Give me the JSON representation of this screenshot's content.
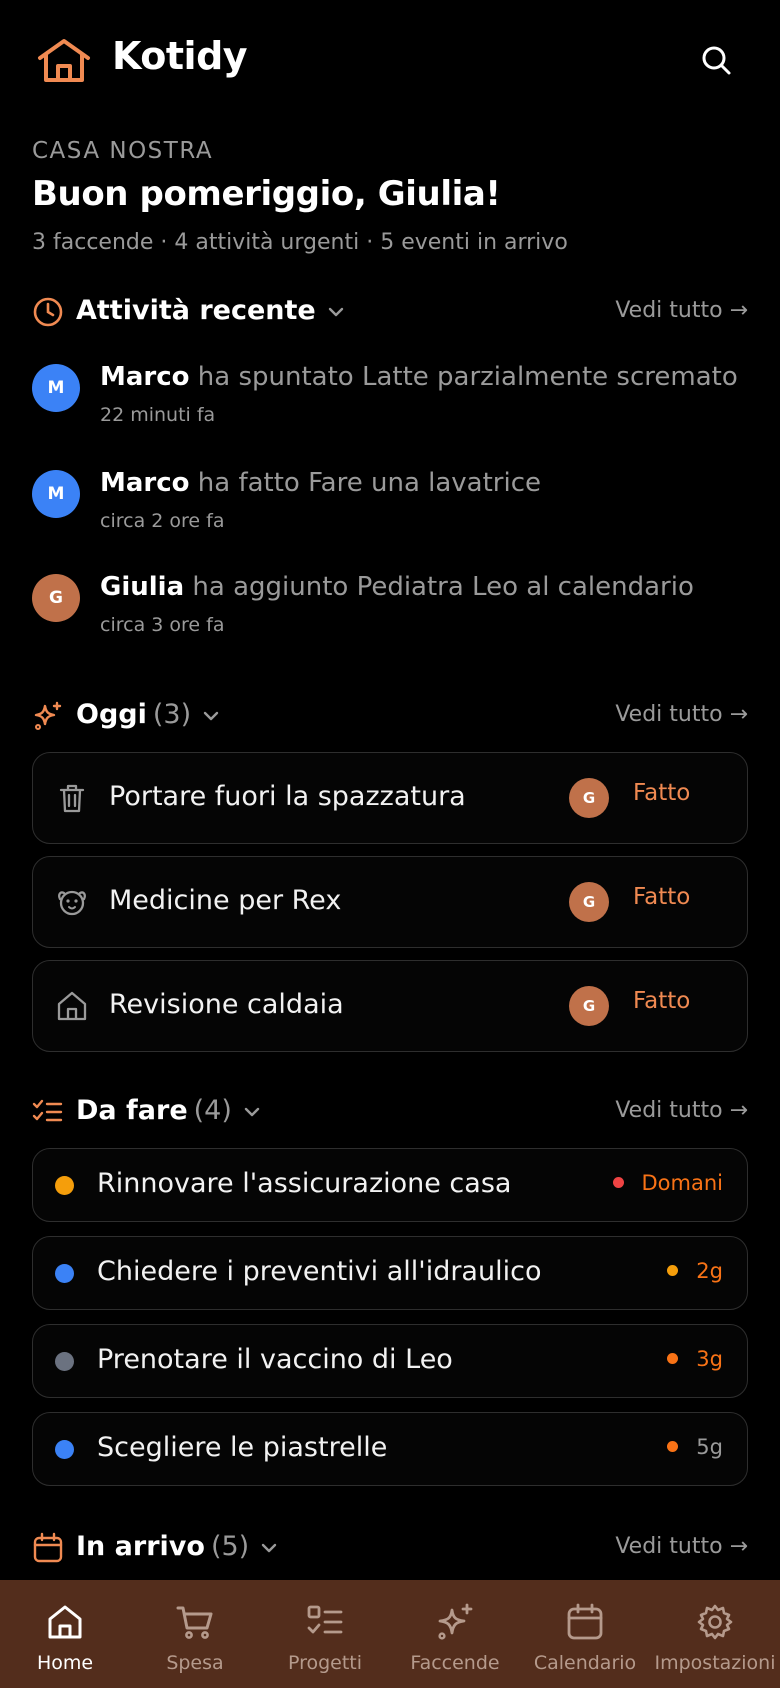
{
  "app": {
    "name": "Kotidy"
  },
  "colors": {
    "accent": "#f08a52",
    "background": "#000000",
    "nav_bg": "#532d1c",
    "blue": "#3b82f6",
    "red": "#ef4444",
    "amber": "#f59e0b",
    "gray": "#6b7280",
    "orange": "#f97316"
  },
  "header": {
    "household": "CASA NOSTRA",
    "greeting": "Buon pomeriggio, Giulia!",
    "summary": "3 faccende · 4 attività urgenti · 5 eventi in arrivo"
  },
  "recent": {
    "title": "Attività recente",
    "see_all": "Vedi tutto →",
    "items": [
      {
        "initial": "M",
        "name": "Marco",
        "action": "ha spuntato Latte parzialmente scremato",
        "time": "22 minuti fa"
      },
      {
        "initial": "M",
        "name": "Marco",
        "action": "ha fatto Fare una lavatrice",
        "time": "circa 2 ore fa"
      },
      {
        "initial": "G",
        "name": "Giulia",
        "action": "ha aggiunto Pediatra Leo al calendario",
        "time": "circa 3 ore fa"
      }
    ]
  },
  "today": {
    "title": "Oggi",
    "count": "(3)",
    "see_all": "Vedi tutto →",
    "items": [
      {
        "icon": "trash-icon",
        "label": "Portare fuori la spazzatura",
        "assignee": "G",
        "action": "Fatto"
      },
      {
        "icon": "pet-icon",
        "label": "Medicine per Rex",
        "assignee": "G",
        "action": "Fatto"
      },
      {
        "icon": "house-icon",
        "label": "Revisione caldaia",
        "assignee": "G",
        "action": "Fatto"
      }
    ]
  },
  "todo": {
    "title": "Da fare",
    "count": "(4)",
    "see_all": "Vedi tutto →",
    "items": [
      {
        "label": "Rinnovare l'assicurazione casa",
        "dot": "#f59e0b",
        "due": "Domani",
        "due_dot": "#ef4444",
        "due_color": "#f97316"
      },
      {
        "label": "Chiedere i preventivi all'idraulico",
        "dot": "#3b82f6",
        "due": "2g",
        "due_dot": "#f59e0b",
        "due_color": "#f97316"
      },
      {
        "label": "Prenotare il vaccino di Leo",
        "dot": "#6b7280",
        "due": "3g",
        "due_dot": "#f97316",
        "due_color": "#f97316"
      },
      {
        "label": "Scegliere le piastrelle",
        "dot": "#3b82f6",
        "due": "5g",
        "due_dot": "#f97316",
        "due_color": "#9a9a9a"
      }
    ]
  },
  "upcoming": {
    "title": "In arrivo",
    "count": "(5)",
    "see_all": "Vedi tutto →"
  },
  "nav": {
    "items": [
      {
        "icon": "home-icon",
        "label": "Home",
        "active": true
      },
      {
        "icon": "cart-icon",
        "label": "Spesa",
        "active": false
      },
      {
        "icon": "checklist-icon",
        "label": "Progetti",
        "active": false
      },
      {
        "icon": "sparkles-icon",
        "label": "Faccende",
        "active": false
      },
      {
        "icon": "calendar-icon",
        "label": "Calendario",
        "active": false
      },
      {
        "icon": "settings-icon",
        "label": "Impostazioni",
        "active": false
      }
    ]
  }
}
